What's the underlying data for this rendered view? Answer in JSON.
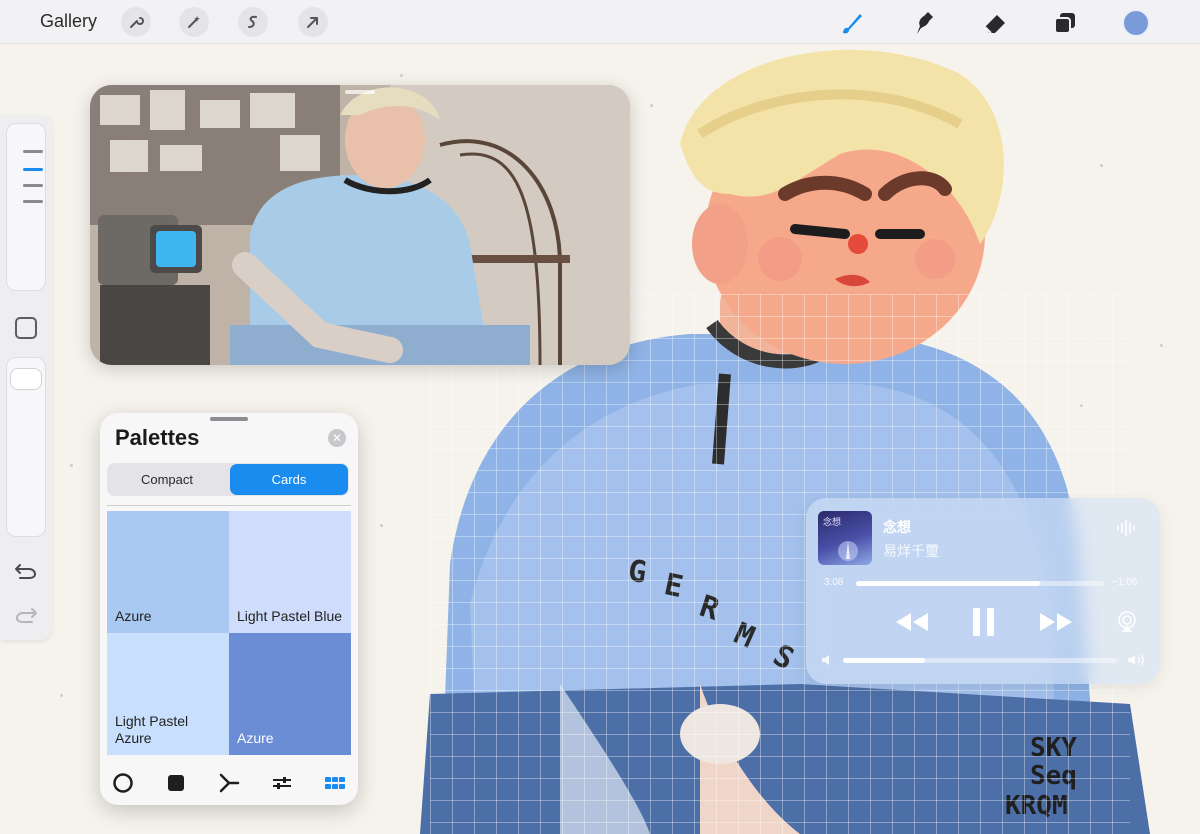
{
  "app": {
    "gallery_label": "Gallery",
    "accent_color": "#1a8cf0",
    "current_color": "#7a9ad9"
  },
  "toolbar": {
    "left_tools": [
      "wrench-icon",
      "magic-wand-icon",
      "selection-icon",
      "transform-arrow-icon"
    ],
    "right_tools": [
      "brush-icon",
      "smudge-icon",
      "eraser-icon",
      "layers-icon",
      "color-picker"
    ]
  },
  "sidebar": {
    "brush_size_level": 0.17,
    "opacity_level": 0.03
  },
  "palettes": {
    "title": "Palettes",
    "tabs": {
      "compact": "Compact",
      "cards": "Cards",
      "active": "Cards"
    },
    "cards": [
      {
        "name": "Azure",
        "color": "#a9c9f2"
      },
      {
        "name": "Light Pastel Blue",
        "color": "#cfdcfb"
      },
      {
        "name": "Light Pastel Azure",
        "color": "#c8e0fd"
      },
      {
        "name": "Azure",
        "color": "#6b8dd6"
      }
    ],
    "bottom_tabs": [
      "disc-icon",
      "square-icon",
      "harmony-icon",
      "sliders-icon",
      "palette-grid-icon"
    ],
    "active_bottom_tab": "palette-grid-icon"
  },
  "music": {
    "title": "念想",
    "artist": "易烊千璽",
    "elapsed": "3:08",
    "remaining": "−1:06",
    "progress": 0.74,
    "volume": 0.3
  }
}
